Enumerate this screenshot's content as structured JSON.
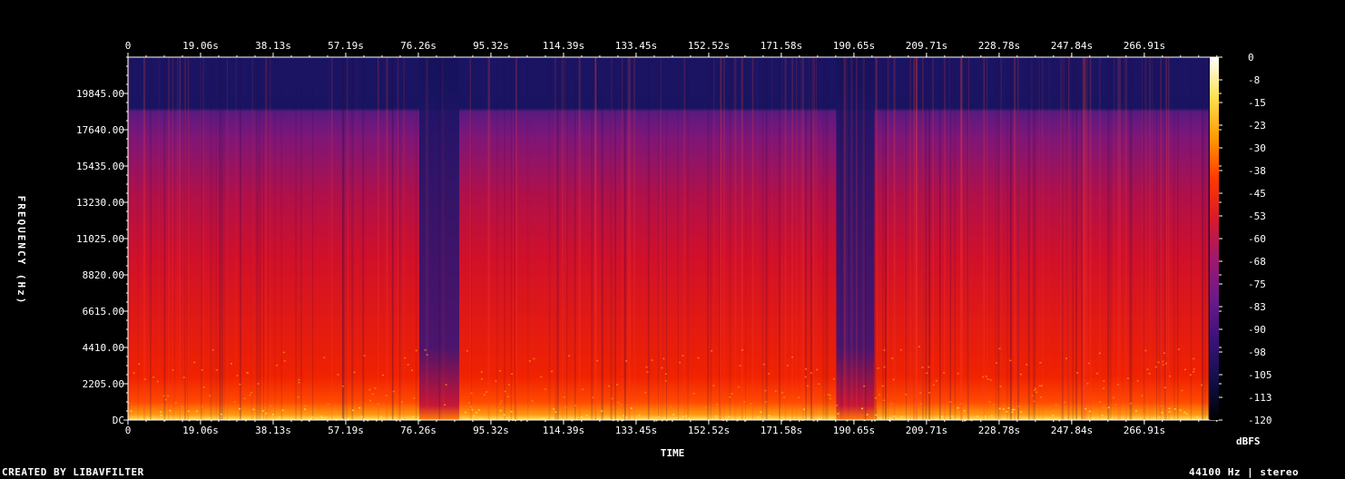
{
  "chart_data": {
    "type": "heatmap",
    "xlabel": "TIME",
    "ylabel": "FREQUENCY (Hz)",
    "colorbar_label": "dBFS",
    "x_ticks": [
      "0",
      "19.06s",
      "38.13s",
      "57.19s",
      "76.26s",
      "95.32s",
      "114.39s",
      "133.45s",
      "152.52s",
      "171.58s",
      "190.65s",
      "209.71s",
      "228.78s",
      "247.84s",
      "266.91s"
    ],
    "x_tick_seconds": [
      0,
      19.06,
      38.13,
      57.19,
      76.26,
      95.32,
      114.39,
      133.45,
      152.52,
      171.58,
      190.65,
      209.71,
      228.78,
      247.84,
      266.91
    ],
    "xlim_seconds": [
      0,
      286.0
    ],
    "y_ticks": [
      "DC",
      "2205.00",
      "4410.00",
      "6615.00",
      "8820.00",
      "11025.00",
      "13230.00",
      "15435.00",
      "17640.00",
      "19845.00"
    ],
    "y_tick_hz": [
      0,
      2205,
      4410,
      6615,
      8820,
      11025,
      13230,
      15435,
      17640,
      19845
    ],
    "ylim_hz": [
      0,
      22050
    ],
    "colorbar_ticks": [
      "0",
      "-8",
      "-15",
      "-23",
      "-30",
      "-38",
      "-45",
      "-53",
      "-60",
      "-68",
      "-75",
      "-83",
      "-90",
      "-98",
      "-105",
      "-113",
      "-120"
    ],
    "zlim_dbfs": [
      -120,
      0
    ],
    "colormap": [
      "#000000",
      "#12104a",
      "#3a127a",
      "#6a1a8a",
      "#a0186e",
      "#d81a2a",
      "#ff3a00",
      "#ff9a00",
      "#ffe050",
      "#ffffff"
    ],
    "quiet_sections_seconds": [
      [
        76.5,
        83
      ],
      [
        83,
        87
      ],
      [
        186,
        196
      ]
    ],
    "lowpass_cutoff_hz": 18900
  },
  "footer": {
    "credit": "CREATED BY LIBAVFILTER",
    "format": "44100 Hz | stereo"
  }
}
